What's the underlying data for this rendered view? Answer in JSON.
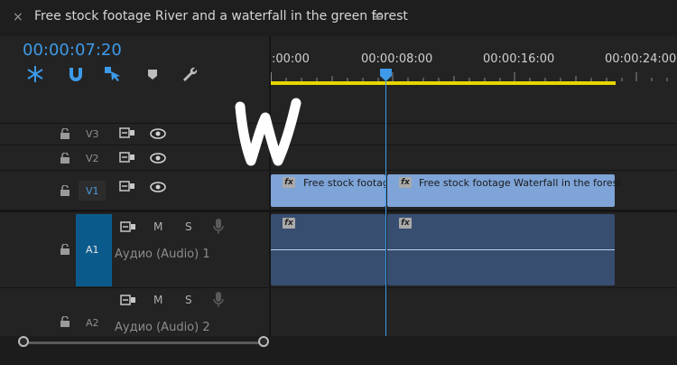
{
  "window": {
    "title": "Free stock footage River and a waterfall in the green forest",
    "close_glyph": "×",
    "menu_glyph": "≡"
  },
  "playhead": {
    "timecode": "00:00:07:20"
  },
  "ruler": {
    "labels": [
      ":00:00",
      "00:00:08:00",
      "00:00:16:00",
      "00:00:24:00"
    ]
  },
  "tracks": {
    "v3": {
      "name": "V3"
    },
    "v2": {
      "name": "V2"
    },
    "v1": {
      "name": "V1"
    },
    "a1": {
      "name": "A1",
      "label": "Аудио (Audio) 1",
      "mute": "M",
      "solo": "S"
    },
    "a2": {
      "name": "A2",
      "label": "Аудио (Audio) 2",
      "mute": "M",
      "solo": "S"
    }
  },
  "clips": {
    "video": [
      {
        "title": "Free stock footag",
        "fx": "fx"
      },
      {
        "title": "Free stock footage Waterfall in the forest",
        "fx": "fx"
      }
    ],
    "audio": [
      {
        "fx": "fx"
      },
      {
        "fx": "fx"
      }
    ]
  },
  "colors": {
    "accent": "#3d9ae8",
    "work_area": "#e5d500",
    "video_clip": "#7ea4d8",
    "audio_clip": "#374e70",
    "target_track": "#0b5a8c"
  },
  "icons": [
    "close-icon",
    "panel-menu-icon",
    "snap-icon",
    "linked-selection-icon",
    "add-marker-icon",
    "marker-icon",
    "settings-wrench-icon",
    "lock-icon",
    "toggle-sync-icon",
    "eye-icon",
    "microphone-icon",
    "watermark-logo"
  ]
}
